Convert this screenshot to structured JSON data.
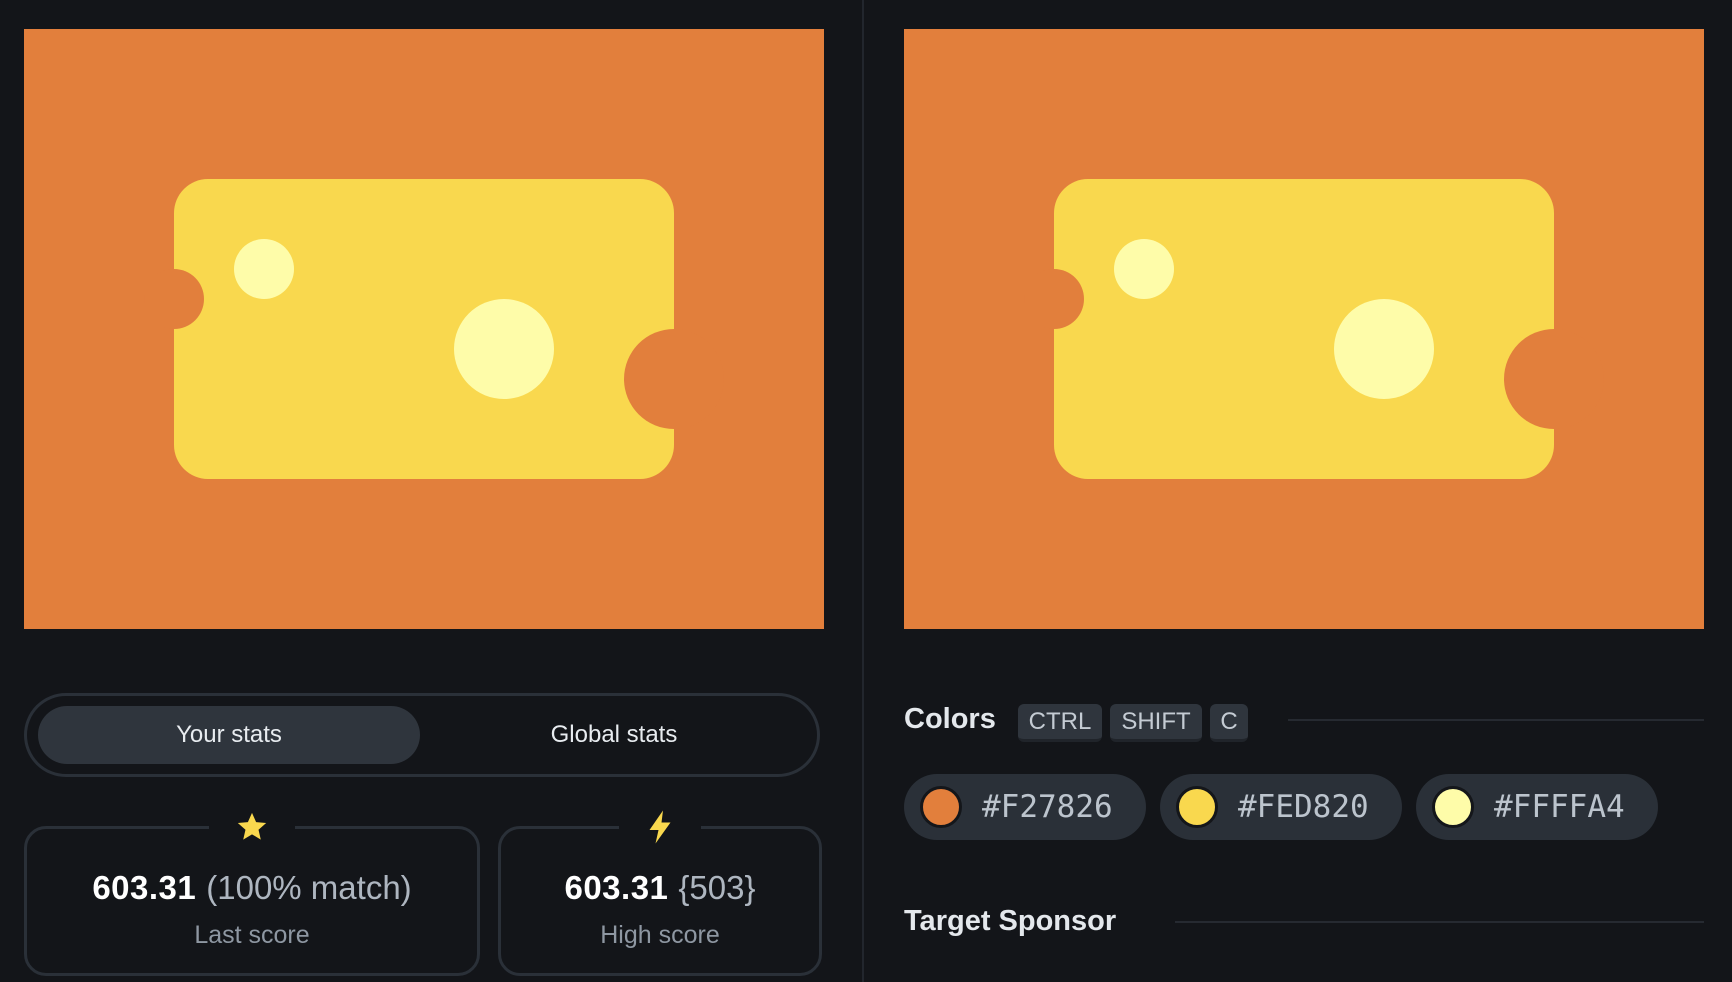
{
  "tabs": {
    "active": "Your stats",
    "inactive": "Global stats"
  },
  "stats": {
    "last": {
      "value": "603.31",
      "extra": "(100% match)",
      "label": "Last score",
      "icon": "star-icon"
    },
    "high": {
      "value": "603.31",
      "extra": "{503}",
      "label": "High score",
      "icon": "lightning-icon"
    }
  },
  "colors": {
    "title": "Colors",
    "shortcut": [
      "CTRL",
      "SHIFT",
      "C"
    ],
    "swatches": [
      {
        "hex": "#F27826",
        "display": "#e27f3c"
      },
      {
        "hex": "#FED820",
        "display": "#f9d84e"
      },
      {
        "hex": "#FFFFA4",
        "display": "#fefca9"
      }
    ]
  },
  "sponsor": {
    "title": "Target Sponsor"
  },
  "palette": {
    "background": "#e27f3c",
    "cheese": "#f9d84e",
    "holes": "#fefca9",
    "accent": "#f9d84e"
  }
}
